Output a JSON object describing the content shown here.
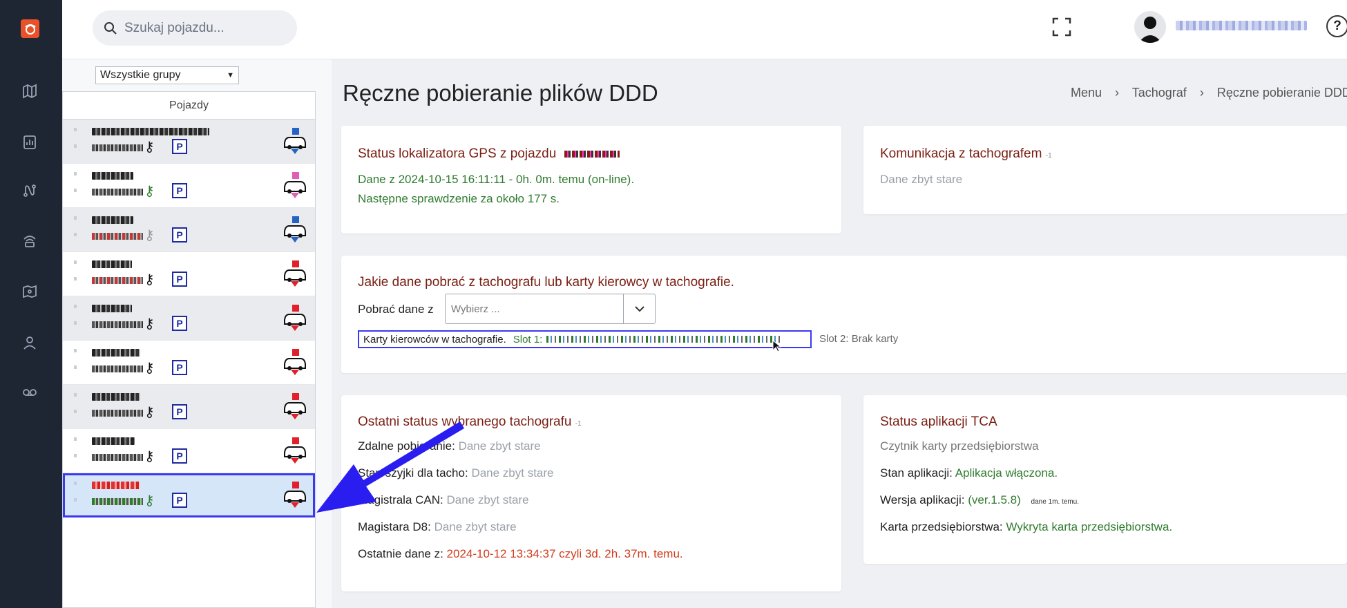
{
  "nav": {
    "icons": [
      "app-logo-icon",
      "map-icon",
      "report-icon",
      "route-icon",
      "antenna-icon",
      "map-zones-icon",
      "driver-icon",
      "voicemail-icon"
    ]
  },
  "topbar": {
    "search_placeholder": "Szukaj pojazdu..."
  },
  "vehicles": {
    "group_select": "Wszystkie grupy",
    "header": "Pojazdy",
    "park_label": "P"
  },
  "page": {
    "title": "Ręczne pobieranie plików DDD",
    "breadcrumb": [
      "Menu",
      "Tachograf",
      "Ręczne pobieranie DDD"
    ]
  },
  "gps": {
    "title": "Status lokalizatora GPS z pojazdu",
    "line1": "Dane z 2024-10-15 16:11:11 - 0h. 0m. temu (on-line).",
    "line2": "Następne sprawdzenie za około 177 s."
  },
  "komunikacja": {
    "title": "Komunikacja z tachografem",
    "badge": "-1",
    "status": "Dane zbyt stare"
  },
  "jakie": {
    "title": "Jakie dane pobrać z tachografu lub karty kierowcy w tachografie.",
    "label": "Pobrać dane z",
    "select_placeholder": "Wybierz ...",
    "karty_label": "Karty kierowców w tachografie.",
    "slot1_label": "Slot 1:",
    "slot2": "Slot 2: Brak karty"
  },
  "ostatni": {
    "title": "Ostatni status wybranego tachografu",
    "badge": "-1",
    "rows": [
      {
        "label": "Zdalne pobieranie:",
        "value": "Dane zbyt stare"
      },
      {
        "label": "Stan szyjki dla tacho:",
        "value": "Dane zbyt stare"
      },
      {
        "label": "Magistrala CAN:",
        "value": "Dane zbyt stare"
      },
      {
        "label": "Magistara D8:",
        "value": "Dane zbyt stare"
      }
    ],
    "last_label": "Ostatnie dane z:",
    "last_value": "2024-10-12 13:34:37 czyli 3d. 2h. 37m. temu."
  },
  "tca": {
    "title": "Status aplikacji TCA",
    "subtitle": "Czytnik karty przedsiębiorstwa",
    "stan_label": "Stan aplikacji:",
    "stan_value": "Aplikacja włączona.",
    "wersja_label": "Wersja aplikacji:",
    "wersja_value": "(ver.1.5.8)",
    "wersja_age": "dane 1m. temu.",
    "karta_label": "Karta przedsiębiorstwa:",
    "karta_value": "Wykryta karta przedsiębiorstwa."
  },
  "colors": {
    "accent": "#3a39f0",
    "title_red": "#7a1d12",
    "ok_green": "#2f7b2f",
    "alert_red": "#d13b1d",
    "muted": "#9aa0a8",
    "rail": "#1e2533"
  }
}
